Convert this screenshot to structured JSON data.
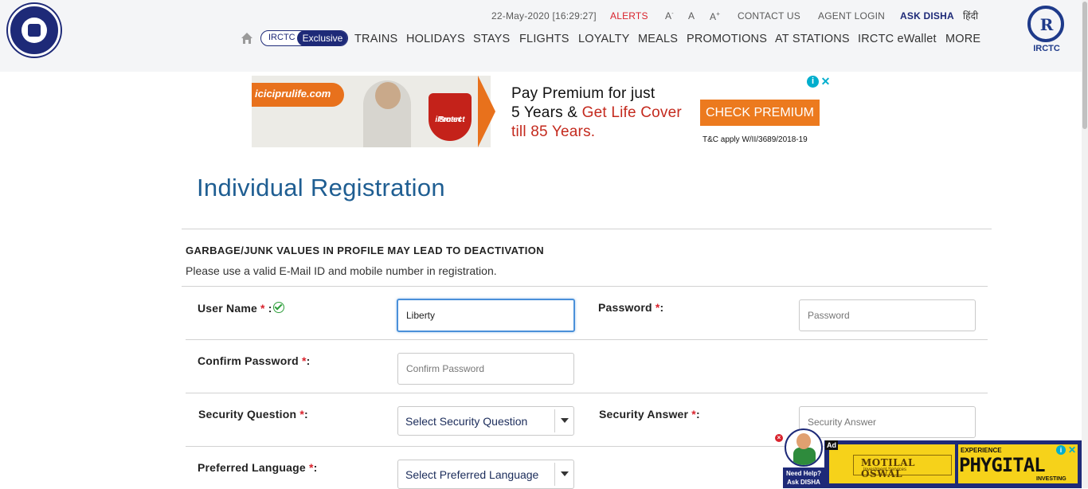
{
  "header": {
    "datetime": "22-May-2020 [16:29:27]",
    "alerts": "ALERTS",
    "font_small": "A",
    "font_small_sup": "-",
    "font_normal": "A",
    "font_large": "A",
    "font_large_sup": "+",
    "contact_us": "CONTACT US",
    "agent_login": "AGENT LOGIN",
    "ask_disha": "ASK DISHA",
    "hindi": "हिंदी",
    "exclusive_prefix": "IRCTC",
    "exclusive_label": "Exclusive",
    "nav": [
      "TRAINS",
      "HOLIDAYS",
      "STAYS",
      "FLIGHTS",
      "LOYALTY",
      "MEALS",
      "PROMOTIONS",
      "AT STATIONS",
      "IRCTC eWallet",
      "MORE"
    ],
    "irctc_logo_text": "IRCTC",
    "irctc_logo_mark": "R"
  },
  "ad_top": {
    "brand": "iciciprulife.com",
    "badge_top": "iProtect",
    "badge_bottom": "Smart",
    "line1": "Pay Premium for just",
    "line2_black": "5 Years & ",
    "line2_red": "Get Life Cover",
    "line3": "till 85 Years.",
    "cta": "CHECK PREMIUM",
    "tc": "T&C apply W/II/3689/2018-19",
    "info": "i",
    "close": "✕"
  },
  "page": {
    "title": "Individual Registration",
    "warning_title": "GARBAGE/JUNK VALUES IN PROFILE MAY LEAD TO DEACTIVATION",
    "warning_text": "Please use a valid E-Mail ID and mobile number in registration."
  },
  "form": {
    "username_label": "User Name",
    "username_value": "Liberty",
    "password_label": "Password",
    "password_placeholder": "Password",
    "confirm_label": "Confirm Password",
    "confirm_placeholder": "Confirm Password",
    "question_label": "Security Question",
    "question_value": "Select Security Question",
    "answer_label": "Security Answer",
    "answer_placeholder": "Security Answer",
    "language_label": "Preferred Language",
    "language_value": "Select Preferred Language",
    "required": "*",
    "colon": ":"
  },
  "disha": {
    "line1": "Need Help?",
    "line2": "Ask DISHA",
    "close": "×"
  },
  "ad_bottom": {
    "ad_tag": "Ad",
    "brand": "MOTILAL OSWAL",
    "brand_sub": "Investment Services",
    "experience": "EXPERIENCE",
    "big": "PHYGITAL",
    "investing": "INVESTING",
    "info": "i",
    "close": "✕"
  },
  "colors": {
    "navy": "#1e2a78",
    "title_blue": "#1f5e92",
    "alert_red": "#d9232d",
    "orange": "#ec7a1e"
  }
}
